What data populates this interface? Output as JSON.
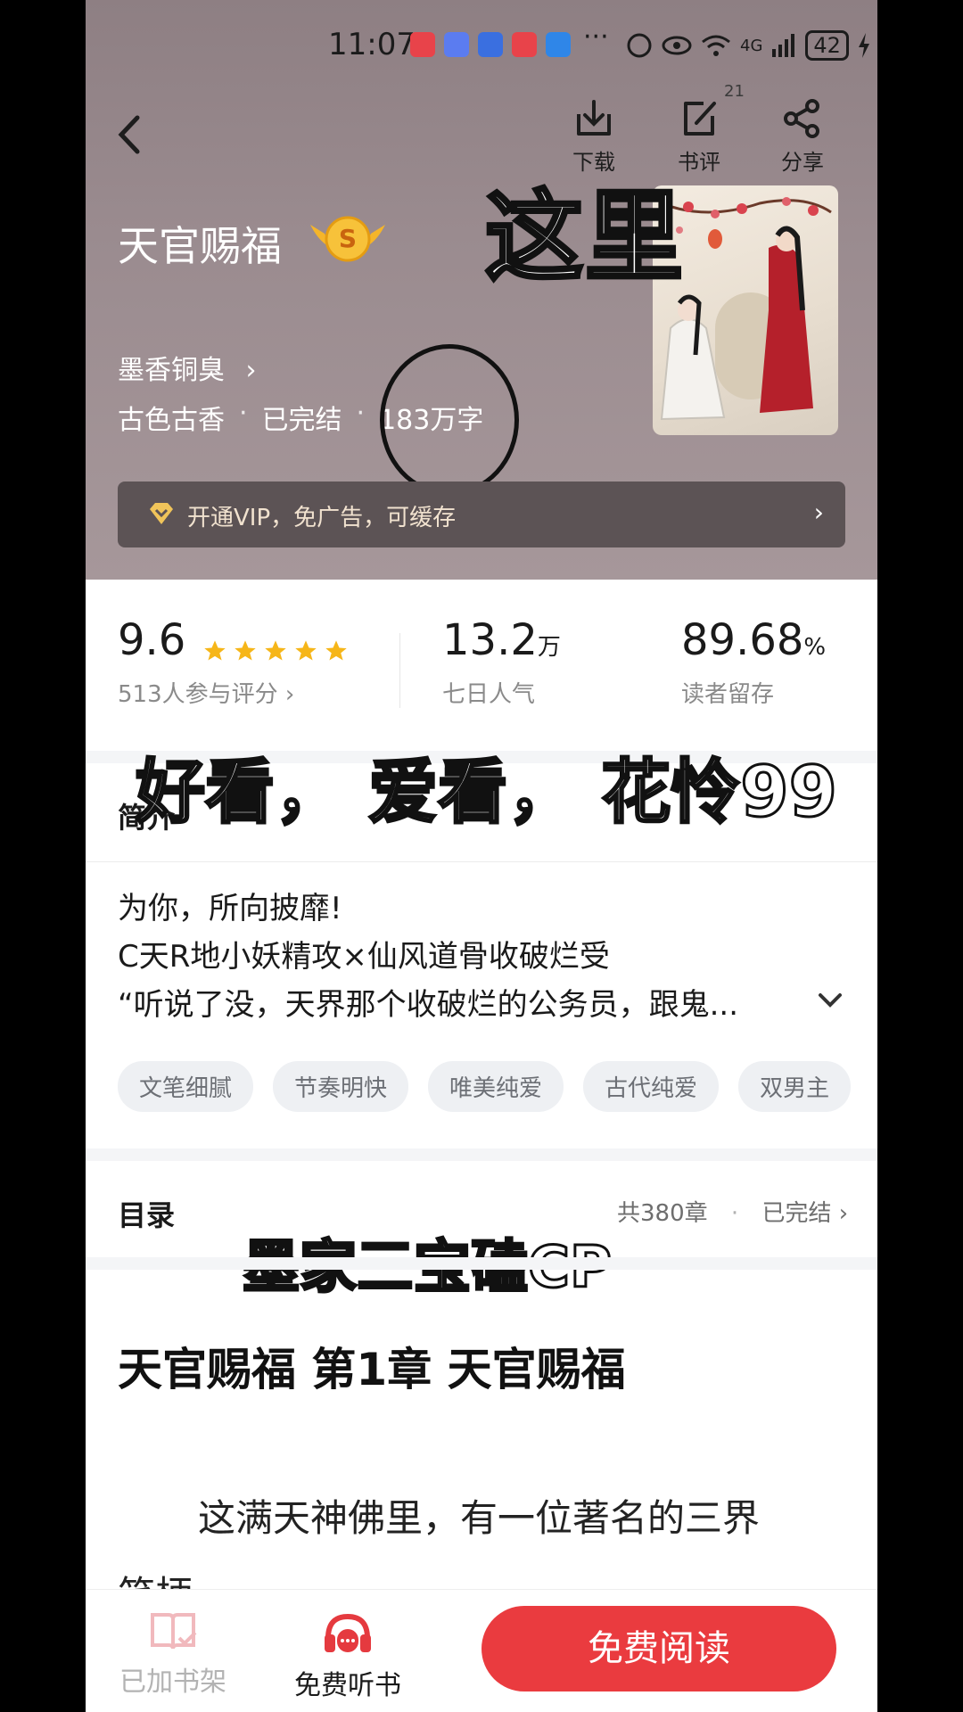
{
  "status_bar": {
    "time": "11:07",
    "more": "···",
    "network": "4G",
    "battery": "42"
  },
  "header": {
    "actions": [
      {
        "label": "下载",
        "icon": "download-icon"
      },
      {
        "label": "书评",
        "icon": "edit-icon",
        "count": "21"
      },
      {
        "label": "分享",
        "icon": "share-icon"
      }
    ]
  },
  "book": {
    "title": "天官赐福",
    "badge": "S",
    "author": "墨香铜臭",
    "author_chevron": "›",
    "genre": "古色古香",
    "status": "已完结",
    "word_count": "183万字",
    "separator": "·"
  },
  "vip": {
    "text": "开通VIP，免广告，可缓存",
    "chevron": "›"
  },
  "stats": {
    "rating": "9.6",
    "rating_sub": "513人参与评分 ›",
    "popularity": "13.2",
    "popularity_unit": "万",
    "popularity_sub": "七日人气",
    "retention": "89.68",
    "retention_unit": "%",
    "retention_sub": "读者留存",
    "stars": 5
  },
  "intro": {
    "label": "简介",
    "lines": [
      "为你，所向披靡!",
      "C天R地小妖精攻×仙风道骨收破烂受",
      "“听说了没，天界那个收破烂的公务员，跟鬼..."
    ]
  },
  "tags": [
    "文笔细腻",
    "节奏明快",
    "唯美纯爱",
    "古代纯爱",
    "双男主"
  ],
  "toc": {
    "label": "目录",
    "count": "共380章",
    "separator": "·",
    "status": "已完结 ›"
  },
  "chapter": {
    "title": "天官赐福 第1章  天官赐福",
    "body_lines": [
      "这满天神佛里，有一位著名的三界",
      "笑柄"
    ]
  },
  "overlays": {
    "here": "这里",
    "comment": "好看， 爱看， 花怜99",
    "cp": "墨家三宝磕CP"
  },
  "bottom": {
    "shelf": "已加书架",
    "listen": "免费听书",
    "read": "免费阅读"
  },
  "colors": {
    "accent": "#ea3b3f",
    "star": "#f6b619",
    "vip_gold": "#f0c45a"
  }
}
